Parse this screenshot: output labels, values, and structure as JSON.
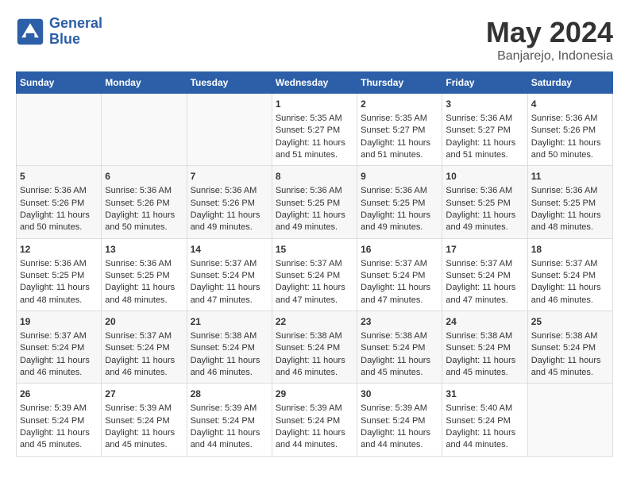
{
  "header": {
    "logo_line1": "General",
    "logo_line2": "Blue",
    "month_year": "May 2024",
    "location": "Banjarejo, Indonesia"
  },
  "days_of_week": [
    "Sunday",
    "Monday",
    "Tuesday",
    "Wednesday",
    "Thursday",
    "Friday",
    "Saturday"
  ],
  "weeks": [
    [
      {
        "day": "",
        "data": []
      },
      {
        "day": "",
        "data": []
      },
      {
        "day": "",
        "data": []
      },
      {
        "day": "1",
        "data": [
          "Sunrise: 5:35 AM",
          "Sunset: 5:27 PM",
          "Daylight: 11 hours",
          "and 51 minutes."
        ]
      },
      {
        "day": "2",
        "data": [
          "Sunrise: 5:35 AM",
          "Sunset: 5:27 PM",
          "Daylight: 11 hours",
          "and 51 minutes."
        ]
      },
      {
        "day": "3",
        "data": [
          "Sunrise: 5:36 AM",
          "Sunset: 5:27 PM",
          "Daylight: 11 hours",
          "and 51 minutes."
        ]
      },
      {
        "day": "4",
        "data": [
          "Sunrise: 5:36 AM",
          "Sunset: 5:26 PM",
          "Daylight: 11 hours",
          "and 50 minutes."
        ]
      }
    ],
    [
      {
        "day": "5",
        "data": [
          "Sunrise: 5:36 AM",
          "Sunset: 5:26 PM",
          "Daylight: 11 hours",
          "and 50 minutes."
        ]
      },
      {
        "day": "6",
        "data": [
          "Sunrise: 5:36 AM",
          "Sunset: 5:26 PM",
          "Daylight: 11 hours",
          "and 50 minutes."
        ]
      },
      {
        "day": "7",
        "data": [
          "Sunrise: 5:36 AM",
          "Sunset: 5:26 PM",
          "Daylight: 11 hours",
          "and 49 minutes."
        ]
      },
      {
        "day": "8",
        "data": [
          "Sunrise: 5:36 AM",
          "Sunset: 5:25 PM",
          "Daylight: 11 hours",
          "and 49 minutes."
        ]
      },
      {
        "day": "9",
        "data": [
          "Sunrise: 5:36 AM",
          "Sunset: 5:25 PM",
          "Daylight: 11 hours",
          "and 49 minutes."
        ]
      },
      {
        "day": "10",
        "data": [
          "Sunrise: 5:36 AM",
          "Sunset: 5:25 PM",
          "Daylight: 11 hours",
          "and 49 minutes."
        ]
      },
      {
        "day": "11",
        "data": [
          "Sunrise: 5:36 AM",
          "Sunset: 5:25 PM",
          "Daylight: 11 hours",
          "and 48 minutes."
        ]
      }
    ],
    [
      {
        "day": "12",
        "data": [
          "Sunrise: 5:36 AM",
          "Sunset: 5:25 PM",
          "Daylight: 11 hours",
          "and 48 minutes."
        ]
      },
      {
        "day": "13",
        "data": [
          "Sunrise: 5:36 AM",
          "Sunset: 5:25 PM",
          "Daylight: 11 hours",
          "and 48 minutes."
        ]
      },
      {
        "day": "14",
        "data": [
          "Sunrise: 5:37 AM",
          "Sunset: 5:24 PM",
          "Daylight: 11 hours",
          "and 47 minutes."
        ]
      },
      {
        "day": "15",
        "data": [
          "Sunrise: 5:37 AM",
          "Sunset: 5:24 PM",
          "Daylight: 11 hours",
          "and 47 minutes."
        ]
      },
      {
        "day": "16",
        "data": [
          "Sunrise: 5:37 AM",
          "Sunset: 5:24 PM",
          "Daylight: 11 hours",
          "and 47 minutes."
        ]
      },
      {
        "day": "17",
        "data": [
          "Sunrise: 5:37 AM",
          "Sunset: 5:24 PM",
          "Daylight: 11 hours",
          "and 47 minutes."
        ]
      },
      {
        "day": "18",
        "data": [
          "Sunrise: 5:37 AM",
          "Sunset: 5:24 PM",
          "Daylight: 11 hours",
          "and 46 minutes."
        ]
      }
    ],
    [
      {
        "day": "19",
        "data": [
          "Sunrise: 5:37 AM",
          "Sunset: 5:24 PM",
          "Daylight: 11 hours",
          "and 46 minutes."
        ]
      },
      {
        "day": "20",
        "data": [
          "Sunrise: 5:37 AM",
          "Sunset: 5:24 PM",
          "Daylight: 11 hours",
          "and 46 minutes."
        ]
      },
      {
        "day": "21",
        "data": [
          "Sunrise: 5:38 AM",
          "Sunset: 5:24 PM",
          "Daylight: 11 hours",
          "and 46 minutes."
        ]
      },
      {
        "day": "22",
        "data": [
          "Sunrise: 5:38 AM",
          "Sunset: 5:24 PM",
          "Daylight: 11 hours",
          "and 46 minutes."
        ]
      },
      {
        "day": "23",
        "data": [
          "Sunrise: 5:38 AM",
          "Sunset: 5:24 PM",
          "Daylight: 11 hours",
          "and 45 minutes."
        ]
      },
      {
        "day": "24",
        "data": [
          "Sunrise: 5:38 AM",
          "Sunset: 5:24 PM",
          "Daylight: 11 hours",
          "and 45 minutes."
        ]
      },
      {
        "day": "25",
        "data": [
          "Sunrise: 5:38 AM",
          "Sunset: 5:24 PM",
          "Daylight: 11 hours",
          "and 45 minutes."
        ]
      }
    ],
    [
      {
        "day": "26",
        "data": [
          "Sunrise: 5:39 AM",
          "Sunset: 5:24 PM",
          "Daylight: 11 hours",
          "and 45 minutes."
        ]
      },
      {
        "day": "27",
        "data": [
          "Sunrise: 5:39 AM",
          "Sunset: 5:24 PM",
          "Daylight: 11 hours",
          "and 45 minutes."
        ]
      },
      {
        "day": "28",
        "data": [
          "Sunrise: 5:39 AM",
          "Sunset: 5:24 PM",
          "Daylight: 11 hours",
          "and 44 minutes."
        ]
      },
      {
        "day": "29",
        "data": [
          "Sunrise: 5:39 AM",
          "Sunset: 5:24 PM",
          "Daylight: 11 hours",
          "and 44 minutes."
        ]
      },
      {
        "day": "30",
        "data": [
          "Sunrise: 5:39 AM",
          "Sunset: 5:24 PM",
          "Daylight: 11 hours",
          "and 44 minutes."
        ]
      },
      {
        "day": "31",
        "data": [
          "Sunrise: 5:40 AM",
          "Sunset: 5:24 PM",
          "Daylight: 11 hours",
          "and 44 minutes."
        ]
      },
      {
        "day": "",
        "data": []
      }
    ]
  ]
}
